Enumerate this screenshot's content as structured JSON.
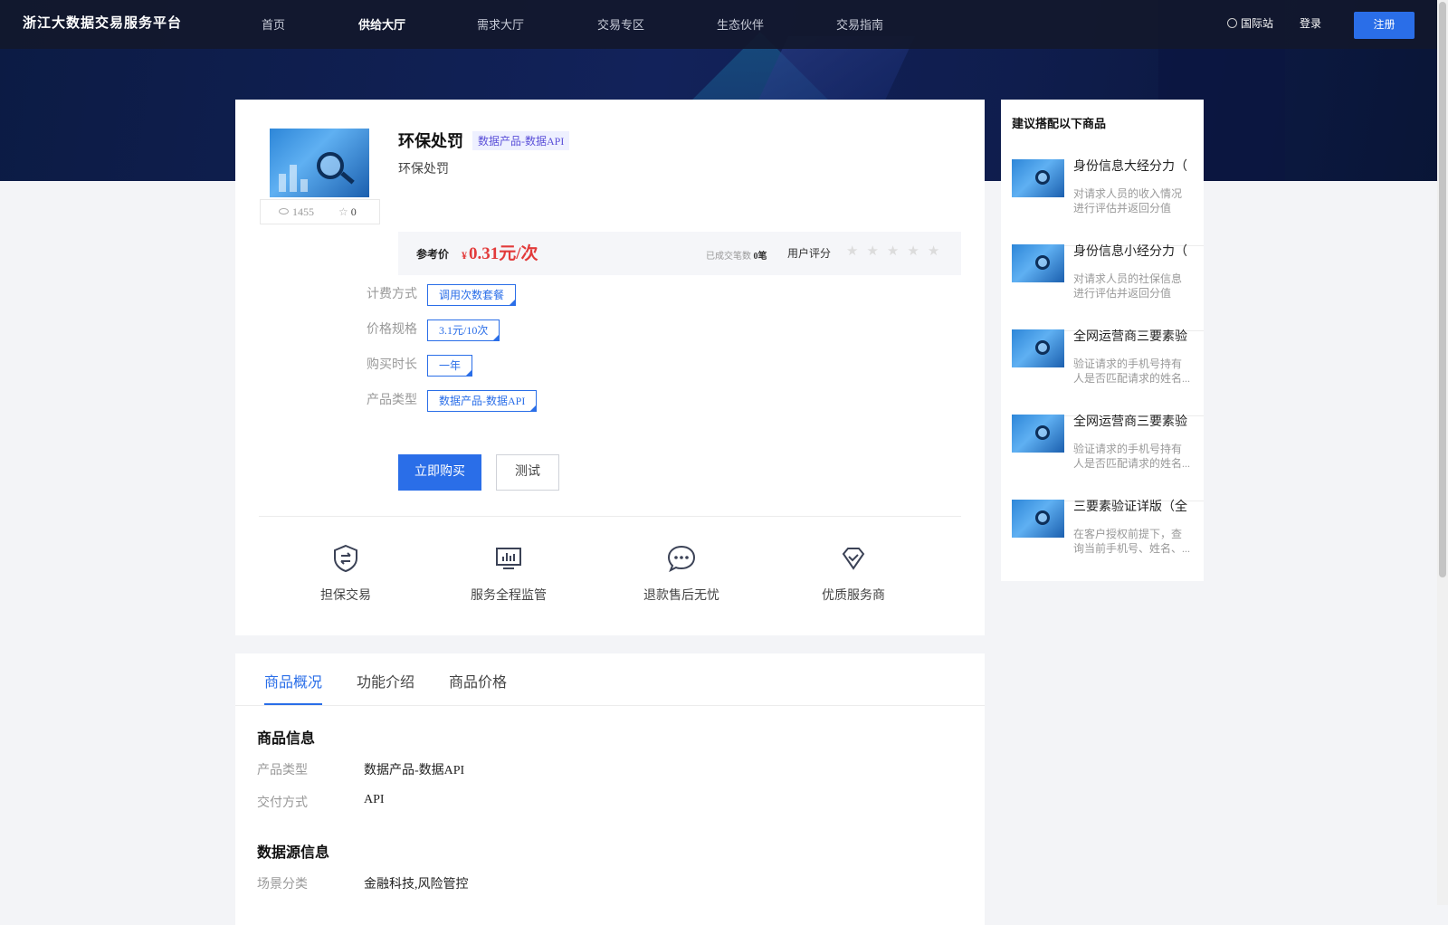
{
  "header": {
    "logo": "浙江大数据交易服务平台",
    "nav": [
      "首页",
      "供给大厅",
      "需求大厅",
      "交易专区",
      "生态伙伴",
      "交易指南"
    ],
    "active_nav": "供给大厅",
    "intl": "国际站",
    "login": "登录",
    "register": "注册"
  },
  "product": {
    "title": "环保处罚",
    "tag": "数据产品-数据API",
    "subtitle": "环保处罚",
    "views": "1455",
    "favorites": "0",
    "price_label": "参考价",
    "currency": "¥",
    "price": "0.31元/次",
    "sold_label": "已成交笔数",
    "sold_count": "0笔",
    "rating_label": "用户评分",
    "rating": 0,
    "rating_max": 5
  },
  "options": [
    {
      "label": "计费方式",
      "value": "调用次数套餐"
    },
    {
      "label": "价格规格",
      "value": "3.1元/10次"
    },
    {
      "label": "购买时长",
      "value": "一年"
    },
    {
      "label": "产品类型",
      "value": "数据产品-数据API"
    }
  ],
  "actions": {
    "buy": "立即购买",
    "test": "测试"
  },
  "services": [
    {
      "label": "担保交易",
      "icon": "shield-exchange-icon"
    },
    {
      "label": "服务全程监管",
      "icon": "monitor-chart-icon"
    },
    {
      "label": "退款售后无忧",
      "icon": "chat-bubble-icon"
    },
    {
      "label": "优质服务商",
      "icon": "diamond-check-icon"
    }
  ],
  "recommend": {
    "title": "建议搭配以下商品",
    "items": [
      {
        "name": "身份信息大经分力（",
        "desc": "对请求人员的收入情况进行评估并返回分值"
      },
      {
        "name": "身份信息小经分力（",
        "desc": "对请求人员的社保信息进行评估并返回分值"
      },
      {
        "name": "全网运营商三要素验",
        "desc": "验证请求的手机号持有人是否匹配请求的姓名..."
      },
      {
        "name": "全网运营商三要素验",
        "desc": "验证请求的手机号持有人是否匹配请求的姓名..."
      },
      {
        "name": "三要素验证详版（全",
        "desc": "在客户授权前提下，查询当前手机号、姓名、..."
      }
    ]
  },
  "tabs": [
    "商品概况",
    "功能介绍",
    "商品价格"
  ],
  "active_tab": "商品概况",
  "info": {
    "section1": "商品信息",
    "product_type_label": "产品类型",
    "product_type": "数据产品-数据API",
    "delivery_label": "交付方式",
    "delivery": "API",
    "section2": "数据源信息",
    "scene_label": "场景分类",
    "scene": "金融科技,风险管控"
  },
  "colors": {
    "accent": "#2a6ee8",
    "price": "#e23b3b",
    "tag_bg": "#eef0ff",
    "tag_text": "#5a4fd8"
  }
}
